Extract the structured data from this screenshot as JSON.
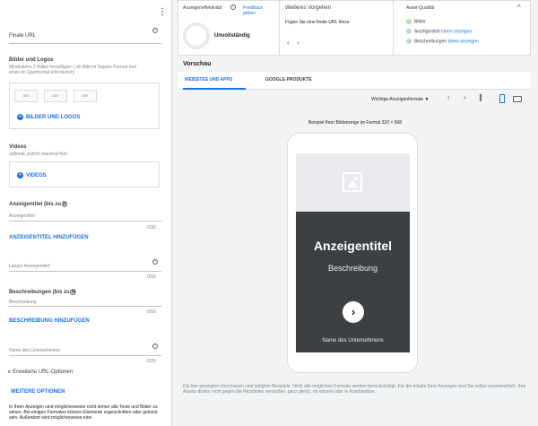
{
  "left": {
    "more_icon": "more-vert-icon",
    "final_url_label": "Finale URL",
    "images": {
      "title": "Bilder und Logos",
      "hint": "Mindestens 2 Bilder hinzufügen ( ein Bild im Square-Format und eines im Querformat erforderlich)",
      "thumbs": [
        "600",
        "600",
        "600"
      ],
      "button": "BILDER UND LOGOS"
    },
    "videos": {
      "title": "Videos",
      "hint": "optional, jedoch maximal fünf",
      "button": "VIDEOS"
    },
    "headlines": {
      "title": "Anzeigentitel (bis zu 5)",
      "placeholder": "Anzeigentitel",
      "counter": "0/30",
      "add_button": "ANZEIGENTITEL HINZUFÜGEN"
    },
    "long_headline": {
      "label": "Langer Anzeigentitel",
      "counter": "0/90"
    },
    "descriptions": {
      "title": "Beschreibungen (bis zu 5)",
      "placeholder": "Beschreibung",
      "counter": "0/90",
      "add_button": "BESCHREIBUNG HINZUFÜGEN"
    },
    "business_name": {
      "label": "Name des Unternehmens",
      "counter": "0/25"
    },
    "url_options": {
      "label": "Erweiterte URL-Optionen",
      "more_button": "WEITERE OPTIONEN"
    },
    "footer_text": "In Ihren Anzeigen sind möglicherweise nicht immer alle Texte und Bilder zu sehen. Bei einigen Formaten können Elemente zugeschnitten oder gekürzt sein. Außerdem wird möglicherweise eine"
  },
  "top": {
    "effectiveness": {
      "title": "Anzeigeneffektivität",
      "feedback": "Feedback geben",
      "status": "Unvollständig"
    },
    "next_steps": {
      "title": "Weiteres Vorgehen",
      "text": "Fügen Sie eine finale URL hinzu"
    },
    "asset_quality": {
      "title": "Asset-Qualität",
      "rows": [
        {
          "label": "Bilder",
          "link": ""
        },
        {
          "label": "Anzeigentitel",
          "link": "Ideen anzeigen"
        },
        {
          "label": "Beschreibungen",
          "link": "Ideen anzeigen"
        }
      ]
    }
  },
  "preview": {
    "title": "Vorschau",
    "tabs": [
      "WEBSITES UND APPS",
      "GOOGLE-PRODUKTE"
    ],
    "format_select": "Wichtige Anzeigenformate",
    "caption": "Beispiel Ihrer Bildanzeige im Format 320 × 568",
    "ad": {
      "headline": "Anzeigentitel",
      "description": "Beschreibung",
      "business": "Name des Unternehmens"
    },
    "disclaimer": "Dis hier gezeigten Vorschauen sind lediglich Beispiele. Nicht alle möglichen Formate werden berücksichtigt. Für die Inhalte Ihrer Anzeigen sind Sie selbst verantwortlich. Ihre Assets dürfen nicht gegen die Richtlinien verstoßen, ganz gleich, ob einzeln oder in Kombination."
  },
  "colors": {
    "accent": "#1a73e8",
    "ad_dark": "#3c4043",
    "quality_dot": "#b7dfbe"
  }
}
